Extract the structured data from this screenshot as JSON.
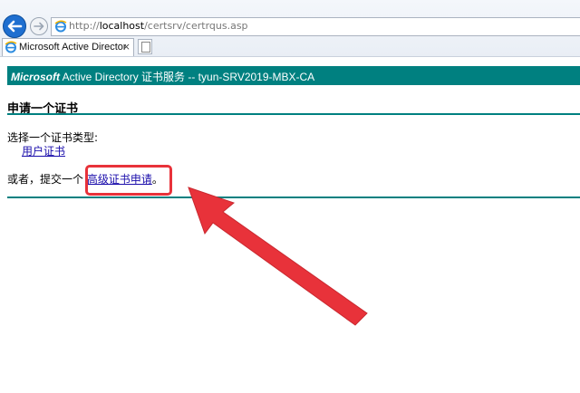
{
  "browser": {
    "url_prefix": "http://",
    "url_host": "localhost",
    "url_path": "/certsrv/certrqus.asp",
    "tab_title": "Microsoft Active Directory...",
    "tab_close": "×"
  },
  "header": {
    "brand": "Microsoft",
    "service": " Active Directory 证书服务  --  tyun-SRV2019-MBX-CA"
  },
  "page": {
    "title": "申请一个证书",
    "select_label": "选择一个证书类型:",
    "user_cert_link": "用户证书",
    "or_text": "或者，提交一个 ",
    "advanced_link": "高级证书申请",
    "period": "。"
  },
  "colors": {
    "teal": "#008080",
    "link": "#1a0dab",
    "annotation_red": "#e8323a"
  },
  "icons": [
    "back-arrow-icon",
    "forward-arrow-icon",
    "ie-logo-icon",
    "new-tab-icon",
    "annotation-arrow"
  ]
}
